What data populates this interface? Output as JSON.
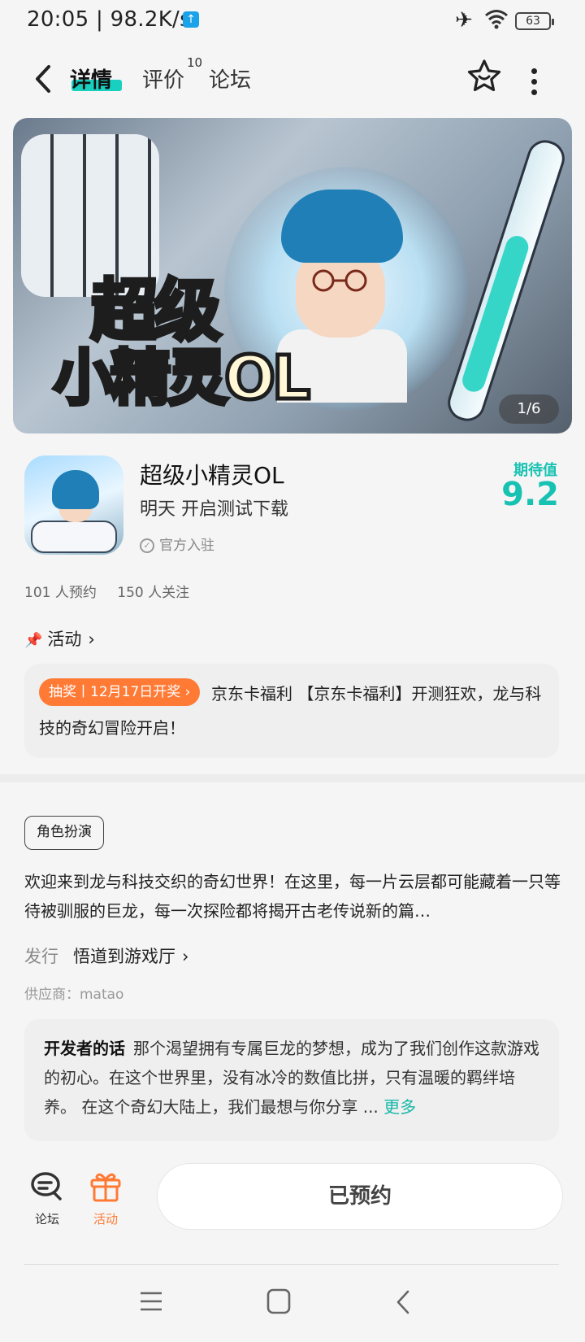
{
  "status_bar": {
    "time": "20:05 | 98.2K/s",
    "battery": "63"
  },
  "nav": {
    "tabs": [
      {
        "label": "详情",
        "active": true
      },
      {
        "label": "评价",
        "count": "10"
      },
      {
        "label": "论坛"
      }
    ]
  },
  "banner": {
    "logo_line1": "超级",
    "logo_line2": "小精灵OL",
    "pager": "1/6"
  },
  "app": {
    "title": "超级小精灵OL",
    "subtitle": "明天 开启测试下载",
    "official": "官方入驻",
    "expect_label": "期待值",
    "expect_score": "9.2",
    "reserves": "101 人预约",
    "followers": "150 人关注"
  },
  "activity": {
    "heading": "活动",
    "tag": "抽奖丨12月17日开奖",
    "text": "京东卡福利 【京东卡福利】开测狂欢，龙与科技的奇幻冒险开启！"
  },
  "info": {
    "genre": "角色扮演",
    "description": "欢迎来到龙与科技交织的奇幻世界！在这里，每一片云层都可能藏着一只等待被驯服的巨龙，每一次探险都将揭开古老传说新的篇…",
    "publisher_label": "发行",
    "publisher": "悟道到游戏厅",
    "supplier": "供应商：matao"
  },
  "developer": {
    "label": "开发者的话",
    "text": "那个渴望拥有专属巨龙的梦想，成为了我们创作这款游戏的初心。在这个世界里，没有冰冷的数值比拼，只有温暖的羁绊培养。 在这个奇幻大陆上，我们最想与你分享 ...",
    "more": "更多"
  },
  "bottom": {
    "forum_label": "论坛",
    "activity_label": "活动",
    "reserve_button": "已预约"
  },
  "colors": {
    "accent": "#18c2b2",
    "activity_orange": "#ff7a35"
  }
}
